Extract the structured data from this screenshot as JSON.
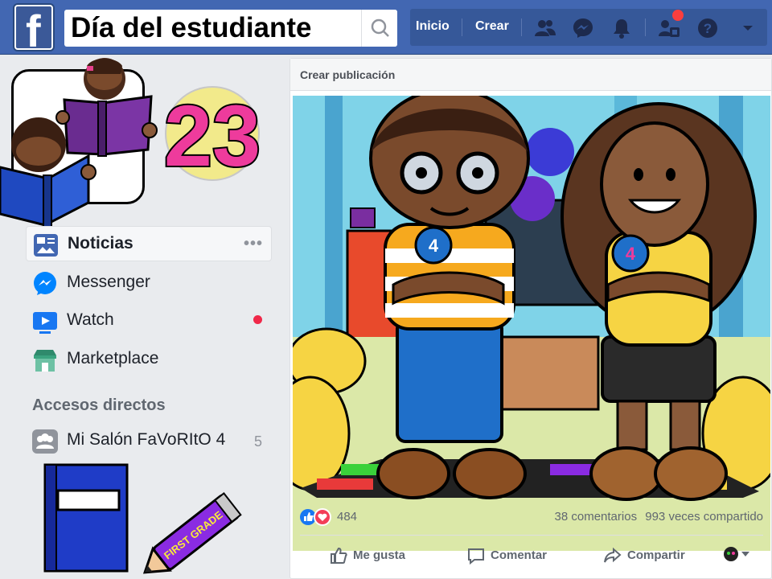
{
  "topbar": {
    "logo_letter": "f",
    "search_text": "Día del estudiante",
    "links": {
      "home": "Inicio",
      "create": "Crear"
    },
    "icons": [
      "friends-icon",
      "messenger-icon",
      "bell-icon",
      "friend-requests-icon",
      "help-icon",
      "caret-down-icon"
    ]
  },
  "profile": {
    "badge_number": "23"
  },
  "sidebar": {
    "items": [
      {
        "label": "Noticias",
        "icon": "news-feed-icon",
        "active": true,
        "more": "•••"
      },
      {
        "label": "Messenger",
        "icon": "messenger-icon"
      },
      {
        "label": "Watch",
        "icon": "watch-icon",
        "has_dot": true
      },
      {
        "label": "Marketplace",
        "icon": "marketplace-icon"
      }
    ],
    "shortcuts_title": "Accesos directos",
    "shortcut": {
      "label": "Mi Salón FaVoRItO 4",
      "count": "5",
      "icon": "group-icon"
    }
  },
  "post": {
    "header": "Crear publicación",
    "badge_left": "4",
    "badge_right": "4",
    "pencil_text": "FIRST GRADE",
    "reactions": {
      "count": "484",
      "types": [
        "like",
        "love"
      ]
    },
    "comments": "38 comentarios",
    "shares": "993 veces compartido",
    "actions": {
      "like": "Me gusta",
      "comment": "Comentar",
      "share": "Compartir"
    }
  },
  "colors": {
    "brand": "#4267b2",
    "nav_dark": "#365899",
    "accent_pink": "#ee3b9c",
    "notification": "#fa3e3e"
  }
}
